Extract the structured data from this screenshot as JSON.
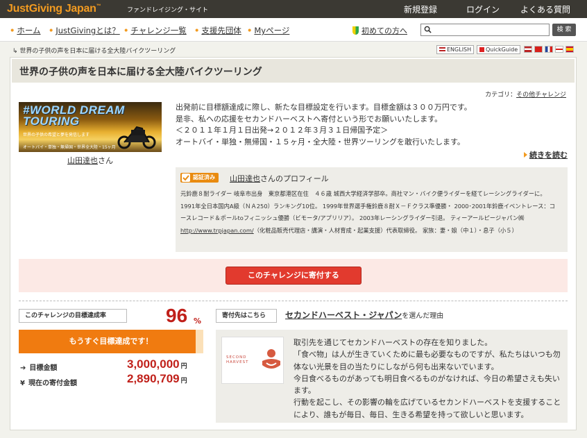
{
  "header": {
    "logo": "JustGiving Japan",
    "logo_tm": "™",
    "subtitle": "ファンドレイジング・サイト",
    "links": [
      "新規登録",
      "ログイン",
      "よくある質問"
    ]
  },
  "nav": {
    "items": [
      "ホーム",
      "JustGivingとは？",
      "チャレンジ一覧",
      "支援先団体",
      "Myページ"
    ],
    "beginner": "初めての方へ",
    "search_placeholder": "",
    "search_button": "検 索"
  },
  "breadcrumb": "世界の子供の声を日本に届ける全大陸バイクツーリング",
  "lang": {
    "english": "ENGLISH",
    "quickguide": "QuickGuide"
  },
  "challenge": {
    "title": "世界の子供の声を日本に届ける全大陸バイクツーリング",
    "category_label": "カテゴリ：",
    "category_value": "その他チャレンジ",
    "banner_title_1": "#WORLD DREAM",
    "banner_title_2": "TOURING",
    "banner_sub": "世界の子供の希望と夢を発信します",
    "banner_sub2": "オートバイ・単独・無帰国・世界全大陸・15ヶ月",
    "owner_name": "山田達也",
    "owner_suffix": "さん",
    "description": [
      "出発前に目標額達成に際し、新たな目標設定を行います。目標金額は３００万円です。",
      "是非、私への応援をセカンドハーベストへ寄付という形でお願いいたします。",
      "＜２０１１年１月１日出発→２０１２年３月３１日帰国予定＞",
      "オートバイ・単独・無帰国・１５ヶ月・全大陸・世界ツーリングを敢行いたします。"
    ],
    "read_more": "続きを読む"
  },
  "profile": {
    "verified": "認証済み",
    "name": "山田達也",
    "suffix": "さんのプロフィール",
    "text_before_link": "元鈴鹿８耐ライダー 岐阜市出身　東京都港区在住　４６歳 城西大学経済学部卒。商社マン・バイク便ライダーを経てレーシングライダーに。 1991年全日本国内A級（ＮＡ250）ランキング10位。 1999年世界選手権鈴鹿８耐Ｘ－Ｆクラス準優勝・ 2000･2001年鈴鹿イベントレース：コースレコード＆ポールtoフィニッシュ優勝（ビモータ/アプリリア）。 2003年レーシングライダー引退。 ティーアールピージャパン㈱",
    "link": "http://www.trpjapan.com/",
    "text_after_link": "（化粧品販売代理店・講演・人材育成・起業支援）代表取締役。 家族：妻・娘（中１）・息子（小５）"
  },
  "donate": {
    "button": "このチャレンジに寄付する"
  },
  "goal": {
    "label": "このチャレンジの目標達成率",
    "percent": "96",
    "percent_sign": "%",
    "progress_fraction": 0.96,
    "progress_text": "もうすぐ目標達成です！",
    "target_label": "目標金額",
    "target_value": "3,000,000",
    "current_label": "現在の寄付金額",
    "current_value": "2,890,709",
    "unit": "円"
  },
  "recipient": {
    "label": "寄付先はこちら",
    "name": "セカンドハーベスト・ジャパン",
    "name_suffix": "を選んだ理由",
    "logo_text_1": "SECOND",
    "logo_text_2": "HARVEST",
    "reason": [
      "取引先を通じてセカンドハーベストの存在を知りました。",
      "「食べ物」は人が生きていくために最も必要なものですが、私たちはいつも勿体ない光景を目の当たりにしながら何も出来ないでいます。",
      "今日食べるものがあっても明日食べるものがなければ、今日の希望さえも失います。",
      "行動を起こし、その影響の輪を広げているセカンドハーベストを支援することにより、誰もが毎日、毎日、生きる希望を持って欲しいと思います。"
    ]
  },
  "colors": {
    "accent": "#f29b21",
    "donate": "#e23a2e",
    "amount": "#c0201a",
    "topbar": "#3b3933"
  }
}
